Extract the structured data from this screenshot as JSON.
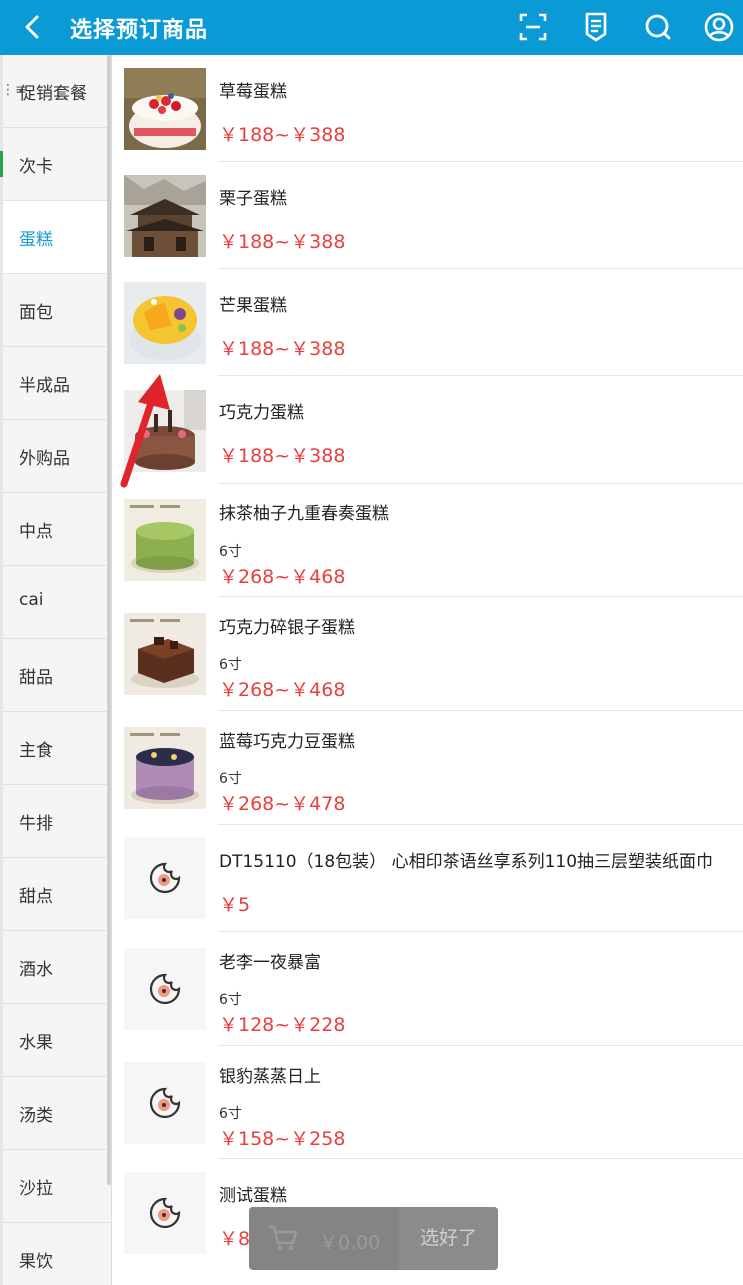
{
  "header": {
    "title": "选择预订商品"
  },
  "sidebar": {
    "items": [
      {
        "label": "促销套餐"
      },
      {
        "label": "次卡"
      },
      {
        "label": "蛋糕"
      },
      {
        "label": "面包"
      },
      {
        "label": "半成品"
      },
      {
        "label": "外购品"
      },
      {
        "label": "中点"
      },
      {
        "label": "cai"
      },
      {
        "label": "甜品"
      },
      {
        "label": "主食"
      },
      {
        "label": "牛排"
      },
      {
        "label": "甜点"
      },
      {
        "label": "酒水"
      },
      {
        "label": "水果"
      },
      {
        "label": "汤类"
      },
      {
        "label": "沙拉"
      },
      {
        "label": "果饮"
      }
    ],
    "active": "蛋糕"
  },
  "products": [
    {
      "name": "草莓蛋糕",
      "spec": "",
      "price": "￥188~￥388"
    },
    {
      "name": "栗子蛋糕",
      "spec": "",
      "price": "￥188~￥388"
    },
    {
      "name": "芒果蛋糕",
      "spec": "",
      "price": "￥188~￥388"
    },
    {
      "name": "巧克力蛋糕",
      "spec": "",
      "price": "￥188~￥388"
    },
    {
      "name": "抹茶柚子九重春奏蛋糕",
      "spec": "6寸",
      "price": "￥268~￥468"
    },
    {
      "name": "巧克力碎银子蛋糕",
      "spec": "6寸",
      "price": "￥268~￥468"
    },
    {
      "name": "蓝莓巧克力豆蛋糕",
      "spec": "6寸",
      "price": "￥268~￥478"
    },
    {
      "name": "DT15110（18包装） 心相印茶语丝享系列110抽三层塑装纸面巾",
      "spec": "",
      "price": "￥5"
    },
    {
      "name": "老李一夜暴富",
      "spec": "6寸",
      "price": "￥128~￥228"
    },
    {
      "name": "银豹蒸蒸日上",
      "spec": "6寸",
      "price": "￥158~￥258"
    },
    {
      "name": "测试蛋糕",
      "spec": "",
      "price": "￥8"
    }
  ],
  "cart": {
    "total": "￥0.00",
    "confirm_label": "选好了"
  },
  "colors": {
    "header": "#0a9ad6",
    "price": "#e8403c",
    "active_category": "#1a9ad6",
    "annotation_arrow": "#e0242b"
  },
  "icons": {
    "back": "chevron-left-icon",
    "scan": "scan-icon",
    "orders": "receipt-icon",
    "search": "search-icon",
    "user": "user-icon",
    "cart": "cart-icon",
    "placeholder": "cookie-placeholder-icon"
  }
}
